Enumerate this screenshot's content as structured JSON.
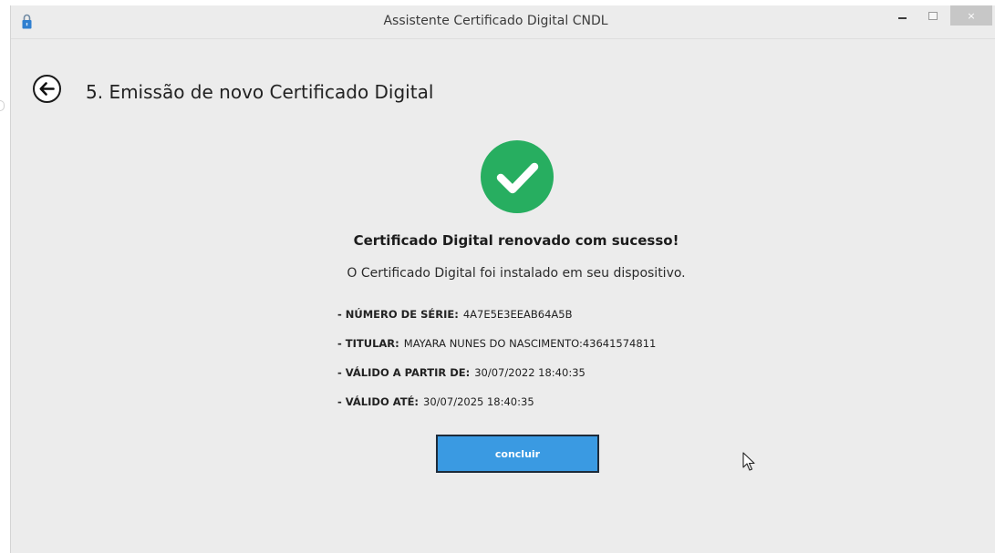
{
  "window": {
    "title": "Assistente Certificado Digital CNDL",
    "controls": {
      "minimize_icon": "minimize-icon",
      "maximize_icon": "maximize-icon",
      "close_symbol": "×"
    }
  },
  "header": {
    "back_icon": "arrow-left-icon",
    "step_title": "5. Emissão de novo Certificado Digital"
  },
  "status": {
    "icon": "check-circle-icon",
    "title": "Certificado Digital renovado com sucesso!",
    "subtitle": "O Certificado Digital foi instalado em seu dispositivo."
  },
  "details": [
    {
      "label": "- NÚMERO DE SÉRIE:",
      "value": "4A7E5E3EEAB64A5B"
    },
    {
      "label": "- TITULAR:",
      "value": "MAYARA NUNES DO NASCIMENTO:43641574811"
    },
    {
      "label": "- VÁLIDO A PARTIR DE:",
      "value": "30/07/2022 18:40:35"
    },
    {
      "label": "- VÁLIDO ATÉ:",
      "value": "30/07/2025 18:40:35"
    }
  ],
  "actions": {
    "concluir_label": "concluir"
  },
  "colors": {
    "success": "#27ae60",
    "button": "#3a9ae2",
    "button_border": "#1d2b3a",
    "window_bg": "#ececec",
    "close_bg": "#c7c7c7"
  }
}
